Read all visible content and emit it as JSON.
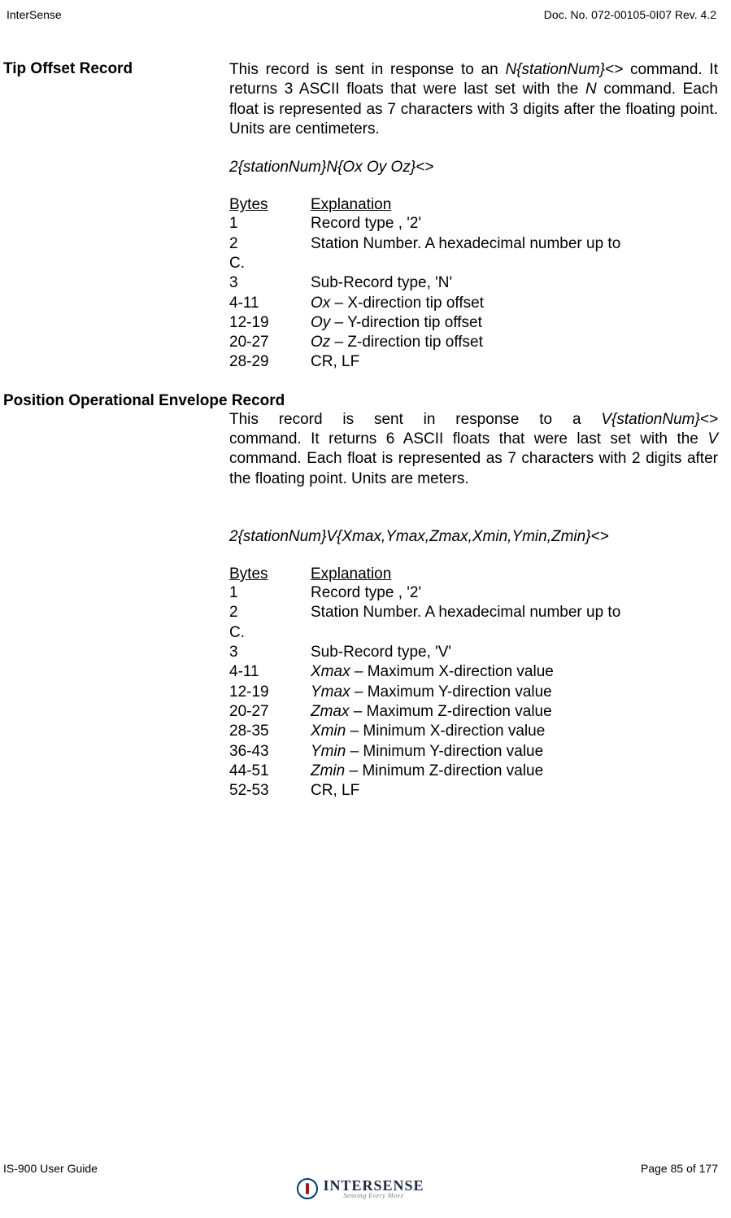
{
  "header": {
    "left": "InterSense",
    "right": "Doc. No. 072-00105-0I07 Rev. 4.2"
  },
  "section1": {
    "title": "Tip Offset Record",
    "desc_pre": "This record is sent in response to an ",
    "desc_cmd": "N{stationNum}<>",
    "desc_post1": " command.  It returns 3 ASCII floats that were last set with the ",
    "desc_cmd2": "N",
    "desc_post2": " command. Each float is represented as 7 characters with 3 digits after the floating point. Units are centimeters.",
    "format": "2{stationNum}N{Ox Oy Oz}<>",
    "bytes_hdr": "Bytes",
    "exp_hdr": "Explanation",
    "rows": [
      {
        "b": "1",
        "pre": "Record type , '2'",
        "it": "",
        "post": ""
      },
      {
        "b": "2",
        "pre": "Station Number. A hexadecimal number up to",
        "it": "",
        "post": ""
      },
      {
        "b": "C.",
        "pre": "",
        "it": "",
        "post": ""
      },
      {
        "b": "3",
        "pre": "Sub-Record type, 'N'",
        "it": "",
        "post": ""
      },
      {
        "b": "4-11",
        "pre": "",
        "it": "Ox",
        "post": " – X-direction tip offset"
      },
      {
        "b": "12-19",
        "pre": "",
        "it": "Oy",
        "post": " – Y-direction tip offset"
      },
      {
        "b": "20-27",
        "pre": "",
        "it": "Oz",
        "post": " – Z-direction tip offset"
      },
      {
        "b": "28-29",
        "pre": "CR, LF",
        "it": "",
        "post": ""
      }
    ]
  },
  "section2": {
    "title": "Position Operational Envelope Record",
    "desc_pre": "This record is sent in response to a ",
    "desc_cmd": "V{stationNum}<>",
    "desc_post1": " command.  It returns 6 ASCII floats that were last set with the ",
    "desc_cmd2": "V",
    "desc_post2": " command. Each float is represented as 7 characters with 2 digits after the floating point. Units are meters.",
    "format": "2{stationNum}V{Xmax,Ymax,Zmax,Xmin,Ymin,Zmin}<>",
    "bytes_hdr": "Bytes",
    "exp_hdr": "Explanation",
    "rows": [
      {
        "b": "1",
        "pre": "Record type , '2'",
        "it": "",
        "post": ""
      },
      {
        "b": "2",
        "pre": "Station Number. A hexadecimal number up to",
        "it": "",
        "post": ""
      },
      {
        "b": "C.",
        "pre": "",
        "it": "",
        "post": ""
      },
      {
        "b": "3",
        "pre": "Sub-Record type, 'V'",
        "it": "",
        "post": ""
      },
      {
        "b": "4-11",
        "pre": "",
        "it": "Xmax",
        "post": " – Maximum X-direction value"
      },
      {
        "b": "12-19",
        "pre": "",
        "it": "Ymax",
        "post": " – Maximum Y-direction value"
      },
      {
        "b": "20-27",
        "pre": "",
        "it": "Zmax",
        "post": " – Maximum Z-direction value"
      },
      {
        "b": "28-35",
        "pre": "",
        "it": "Xmin",
        "post": " – Minimum X-direction value"
      },
      {
        "b": "36-43",
        "pre": "",
        "it": "Ymin",
        "post": " – Minimum Y-direction value"
      },
      {
        "b": "44-51",
        "pre": "",
        "it": "Zmin",
        "post": " – Minimum Z-direction value"
      },
      {
        "b": "52-53",
        "pre": "CR, LF",
        "it": "",
        "post": ""
      }
    ]
  },
  "footer": {
    "left": "IS-900 User Guide",
    "right": "Page 85 of 177",
    "logo_main": "INTERSENSE",
    "logo_sub": "Sensing Every Move"
  }
}
